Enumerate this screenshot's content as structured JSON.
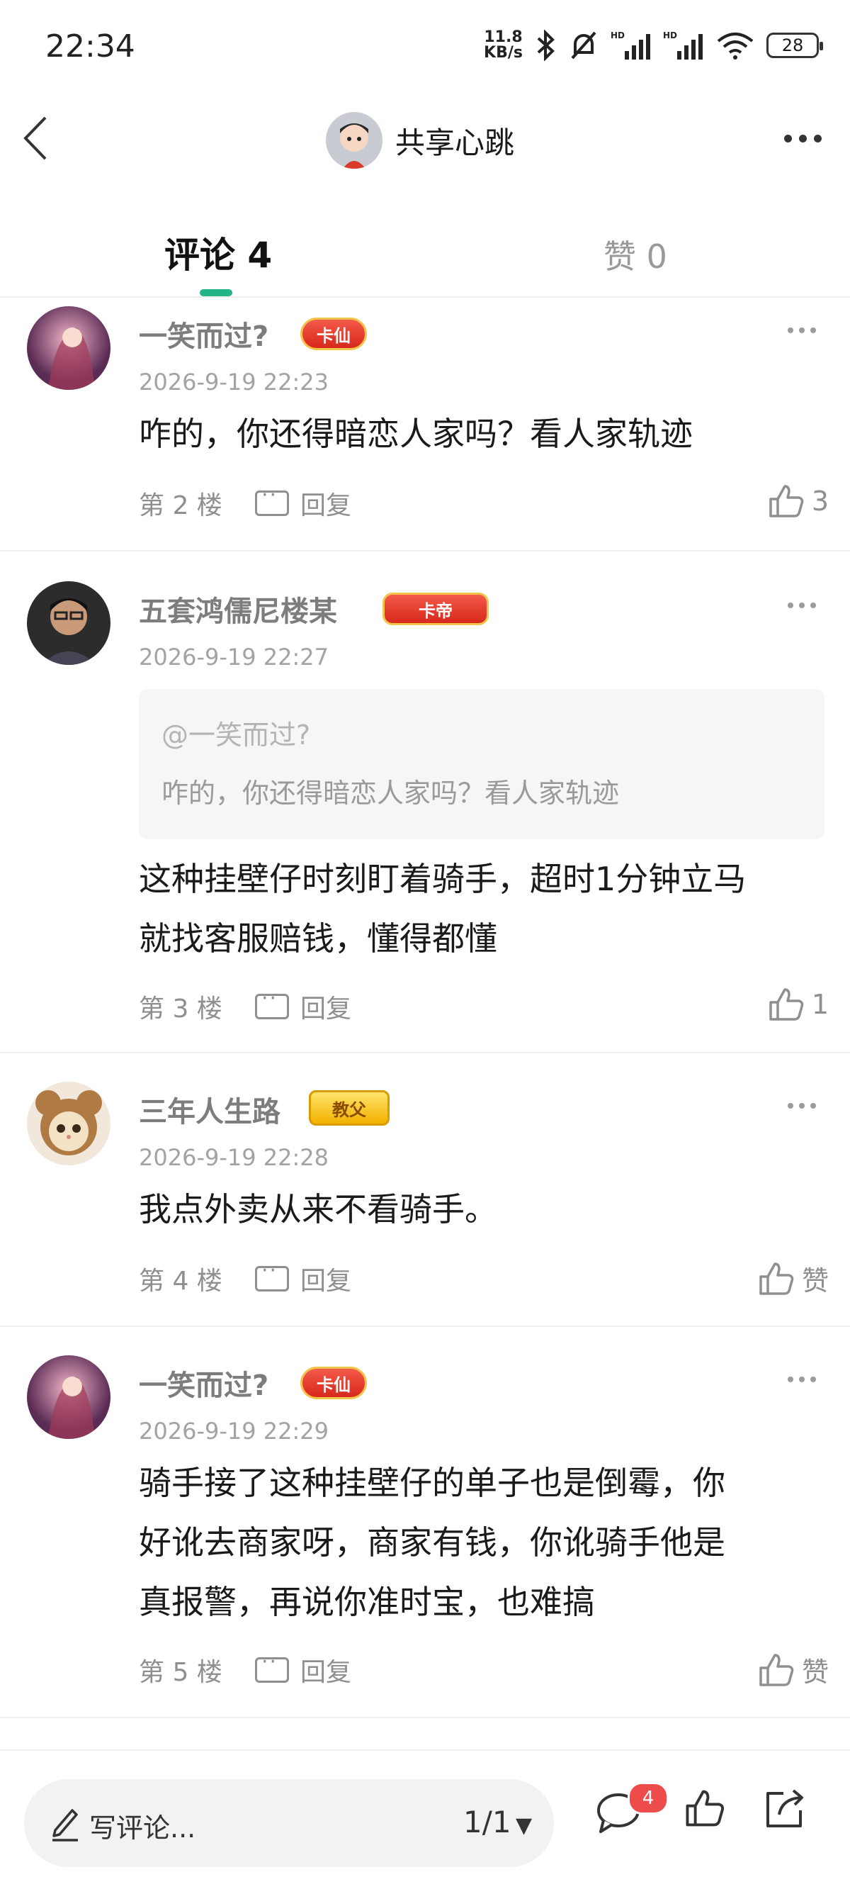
{
  "status_bar": {
    "time": "22:34",
    "net_speed_value": "11.8",
    "net_speed_unit": "KB/s",
    "battery": "28",
    "icons": [
      "bluetooth-icon",
      "mute-bell-icon",
      "hd-signal-icon",
      "hd-signal-icon",
      "wifi-icon",
      "battery-icon"
    ]
  },
  "header": {
    "title": "共享心跳",
    "icons": [
      "back-arrow-icon",
      "avatar",
      "more-dots-icon"
    ]
  },
  "tabs": [
    {
      "label": "评论 4",
      "active": true
    },
    {
      "label": "赞 0",
      "active": false
    }
  ],
  "comments": [
    {
      "username": "一笑而过?",
      "badge": "卡仙",
      "time": "2026-9-19 22:23",
      "content": [
        "咋的，你还得暗恋人家吗？看人家轨迹"
      ],
      "floor": "第 2 楼",
      "reply_label": "回复",
      "likes": "3"
    },
    {
      "username": "五套鸿儒尼楼某",
      "badge": "卡帝",
      "time": "2026-9-19 22:27",
      "quote": {
        "user": "@一笑而过?",
        "text": "咋的，你还得暗恋人家吗？看人家轨迹"
      },
      "content": [
        "这种挂壁仔时刻盯着骑手，超时1分钟立马",
        "就找客服赔钱，懂得都懂"
      ],
      "floor": "第 3 楼",
      "reply_label": "回复",
      "likes": "1"
    },
    {
      "username": "三年人生路",
      "badge": "教父",
      "time": "2026-9-19 22:28",
      "content": [
        "我点外卖从来不看骑手。"
      ],
      "floor": "第 4 楼",
      "reply_label": "回复",
      "likes": "赞"
    },
    {
      "username": "一笑而过?",
      "badge": "卡仙",
      "time": "2026-9-19 22:29",
      "content": [
        "骑手接了这种挂壁仔的单子也是倒霉，你",
        "好讹去商家呀，商家有钱，你讹骑手他是",
        "真报警，再说你准时宝，也难搞"
      ],
      "floor": "第 5 楼",
      "reply_label": "回复",
      "likes": "赞"
    }
  ],
  "bottom_bar": {
    "write_placeholder": "写评论...",
    "page_indicator": "1/1",
    "comment_count": "4"
  },
  "colors": {
    "accent": "#22b387",
    "notification": "#ee4b4b",
    "secondary_text": "#8f8f8f"
  }
}
